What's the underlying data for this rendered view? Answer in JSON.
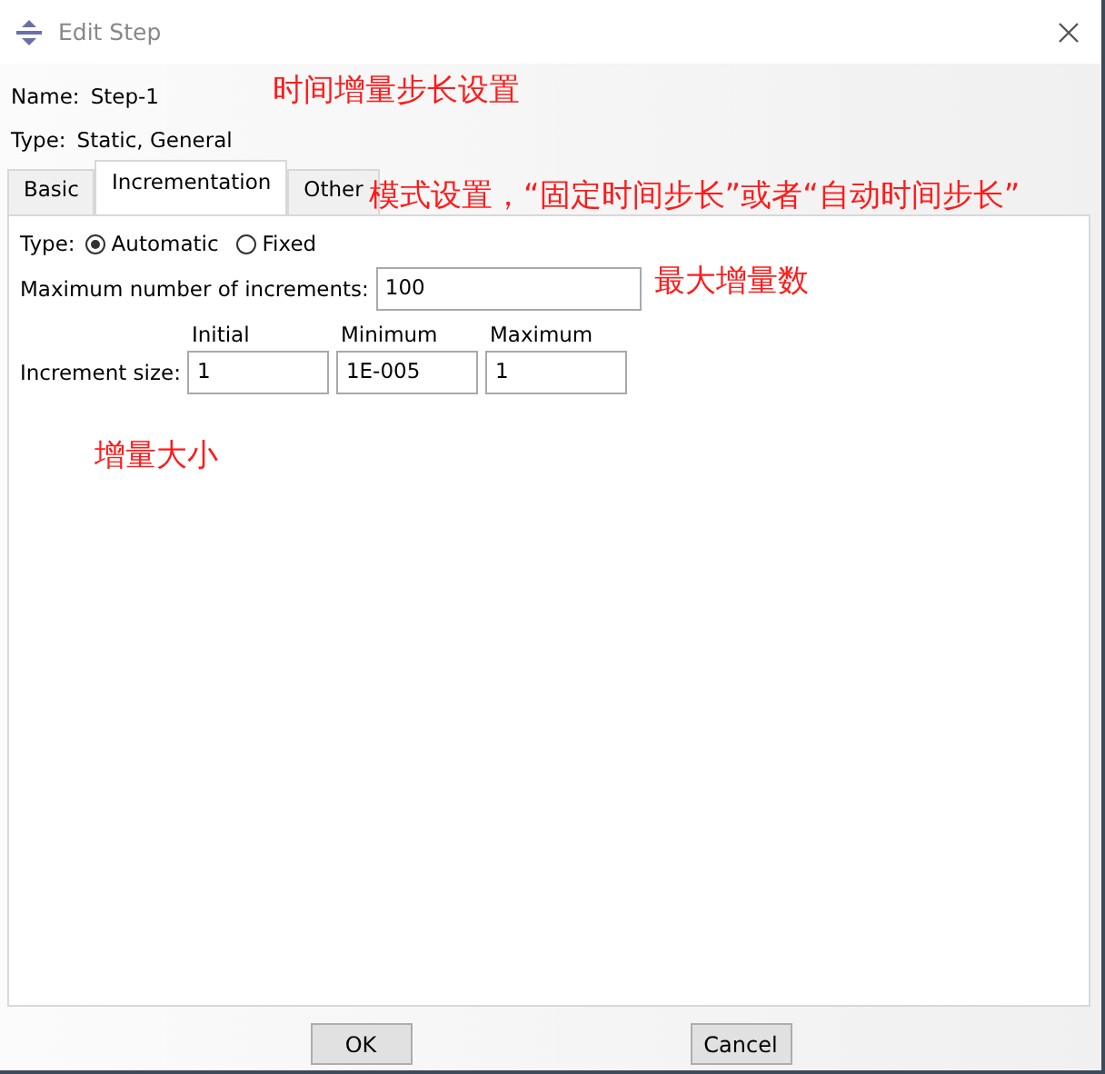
{
  "window": {
    "title": "Edit Step"
  },
  "name": {
    "label": "Name:",
    "value": "Step-1"
  },
  "type": {
    "label": "Type:",
    "value": "Static, General"
  },
  "tabs": [
    {
      "label": "Basic",
      "selected": false
    },
    {
      "label": "Incrementation",
      "selected": true
    },
    {
      "label": "Other",
      "selected": false
    }
  ],
  "increment_type": {
    "label": "Type:",
    "options": [
      {
        "label": "Automatic",
        "selected": true
      },
      {
        "label": "Fixed",
        "selected": false
      }
    ]
  },
  "max_increments": {
    "label": "Maximum number of increments:",
    "value": "100"
  },
  "increment_size": {
    "label": "Increment size:",
    "columns": [
      {
        "heading": "Initial",
        "value": "1"
      },
      {
        "heading": "Minimum",
        "value": "1E-005"
      },
      {
        "heading": "Maximum",
        "value": "1"
      }
    ]
  },
  "annotations": [
    {
      "text": "时间增量步长设置",
      "kind": "title"
    },
    {
      "text": "模式设置，“固定时间步长”或者“自动时间步长”",
      "kind": "mode"
    },
    {
      "text": "最大增量数",
      "kind": "max"
    },
    {
      "text": "增量大小",
      "kind": "size"
    }
  ],
  "buttons": [
    "OK",
    "Cancel"
  ]
}
